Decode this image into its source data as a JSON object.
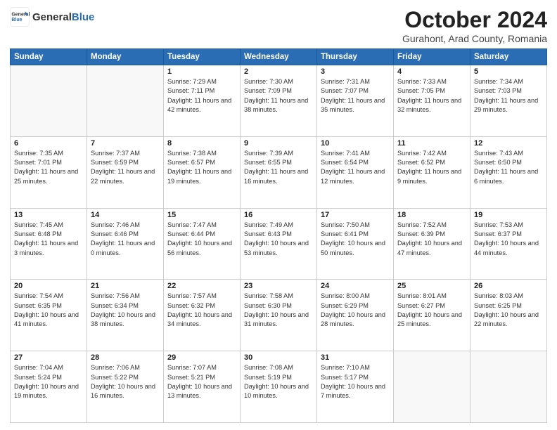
{
  "header": {
    "logo_general": "General",
    "logo_blue": "Blue",
    "title": "October 2024",
    "subtitle": "Gurahont, Arad County, Romania"
  },
  "columns": [
    "Sunday",
    "Monday",
    "Tuesday",
    "Wednesday",
    "Thursday",
    "Friday",
    "Saturday"
  ],
  "weeks": [
    [
      {
        "day": "",
        "info": ""
      },
      {
        "day": "",
        "info": ""
      },
      {
        "day": "1",
        "info": "Sunrise: 7:29 AM\nSunset: 7:11 PM\nDaylight: 11 hours and 42 minutes."
      },
      {
        "day": "2",
        "info": "Sunrise: 7:30 AM\nSunset: 7:09 PM\nDaylight: 11 hours and 38 minutes."
      },
      {
        "day": "3",
        "info": "Sunrise: 7:31 AM\nSunset: 7:07 PM\nDaylight: 11 hours and 35 minutes."
      },
      {
        "day": "4",
        "info": "Sunrise: 7:33 AM\nSunset: 7:05 PM\nDaylight: 11 hours and 32 minutes."
      },
      {
        "day": "5",
        "info": "Sunrise: 7:34 AM\nSunset: 7:03 PM\nDaylight: 11 hours and 29 minutes."
      }
    ],
    [
      {
        "day": "6",
        "info": "Sunrise: 7:35 AM\nSunset: 7:01 PM\nDaylight: 11 hours and 25 minutes."
      },
      {
        "day": "7",
        "info": "Sunrise: 7:37 AM\nSunset: 6:59 PM\nDaylight: 11 hours and 22 minutes."
      },
      {
        "day": "8",
        "info": "Sunrise: 7:38 AM\nSunset: 6:57 PM\nDaylight: 11 hours and 19 minutes."
      },
      {
        "day": "9",
        "info": "Sunrise: 7:39 AM\nSunset: 6:55 PM\nDaylight: 11 hours and 16 minutes."
      },
      {
        "day": "10",
        "info": "Sunrise: 7:41 AM\nSunset: 6:54 PM\nDaylight: 11 hours and 12 minutes."
      },
      {
        "day": "11",
        "info": "Sunrise: 7:42 AM\nSunset: 6:52 PM\nDaylight: 11 hours and 9 minutes."
      },
      {
        "day": "12",
        "info": "Sunrise: 7:43 AM\nSunset: 6:50 PM\nDaylight: 11 hours and 6 minutes."
      }
    ],
    [
      {
        "day": "13",
        "info": "Sunrise: 7:45 AM\nSunset: 6:48 PM\nDaylight: 11 hours and 3 minutes."
      },
      {
        "day": "14",
        "info": "Sunrise: 7:46 AM\nSunset: 6:46 PM\nDaylight: 11 hours and 0 minutes."
      },
      {
        "day": "15",
        "info": "Sunrise: 7:47 AM\nSunset: 6:44 PM\nDaylight: 10 hours and 56 minutes."
      },
      {
        "day": "16",
        "info": "Sunrise: 7:49 AM\nSunset: 6:43 PM\nDaylight: 10 hours and 53 minutes."
      },
      {
        "day": "17",
        "info": "Sunrise: 7:50 AM\nSunset: 6:41 PM\nDaylight: 10 hours and 50 minutes."
      },
      {
        "day": "18",
        "info": "Sunrise: 7:52 AM\nSunset: 6:39 PM\nDaylight: 10 hours and 47 minutes."
      },
      {
        "day": "19",
        "info": "Sunrise: 7:53 AM\nSunset: 6:37 PM\nDaylight: 10 hours and 44 minutes."
      }
    ],
    [
      {
        "day": "20",
        "info": "Sunrise: 7:54 AM\nSunset: 6:35 PM\nDaylight: 10 hours and 41 minutes."
      },
      {
        "day": "21",
        "info": "Sunrise: 7:56 AM\nSunset: 6:34 PM\nDaylight: 10 hours and 38 minutes."
      },
      {
        "day": "22",
        "info": "Sunrise: 7:57 AM\nSunset: 6:32 PM\nDaylight: 10 hours and 34 minutes."
      },
      {
        "day": "23",
        "info": "Sunrise: 7:58 AM\nSunset: 6:30 PM\nDaylight: 10 hours and 31 minutes."
      },
      {
        "day": "24",
        "info": "Sunrise: 8:00 AM\nSunset: 6:29 PM\nDaylight: 10 hours and 28 minutes."
      },
      {
        "day": "25",
        "info": "Sunrise: 8:01 AM\nSunset: 6:27 PM\nDaylight: 10 hours and 25 minutes."
      },
      {
        "day": "26",
        "info": "Sunrise: 8:03 AM\nSunset: 6:25 PM\nDaylight: 10 hours and 22 minutes."
      }
    ],
    [
      {
        "day": "27",
        "info": "Sunrise: 7:04 AM\nSunset: 5:24 PM\nDaylight: 10 hours and 19 minutes."
      },
      {
        "day": "28",
        "info": "Sunrise: 7:06 AM\nSunset: 5:22 PM\nDaylight: 10 hours and 16 minutes."
      },
      {
        "day": "29",
        "info": "Sunrise: 7:07 AM\nSunset: 5:21 PM\nDaylight: 10 hours and 13 minutes."
      },
      {
        "day": "30",
        "info": "Sunrise: 7:08 AM\nSunset: 5:19 PM\nDaylight: 10 hours and 10 minutes."
      },
      {
        "day": "31",
        "info": "Sunrise: 7:10 AM\nSunset: 5:17 PM\nDaylight: 10 hours and 7 minutes."
      },
      {
        "day": "",
        "info": ""
      },
      {
        "day": "",
        "info": ""
      }
    ]
  ]
}
